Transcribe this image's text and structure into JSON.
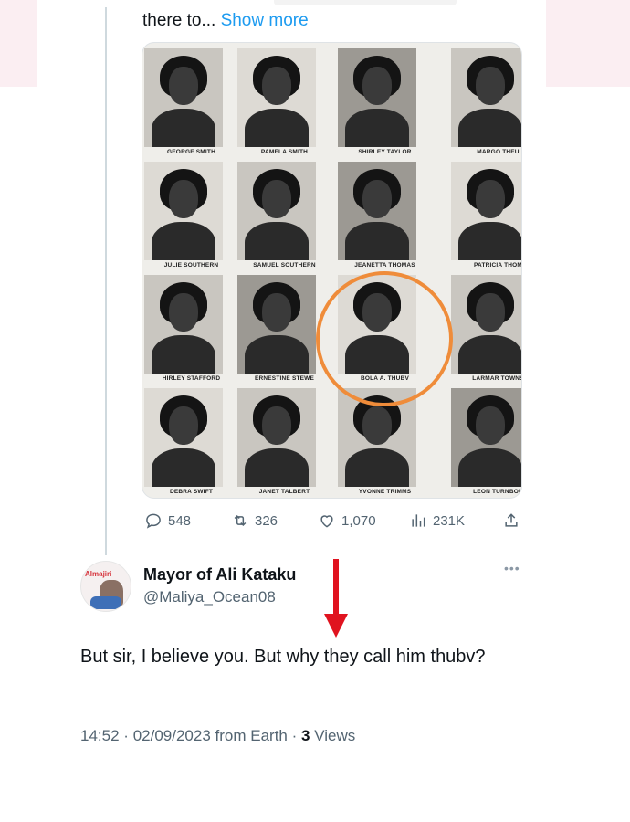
{
  "original_tweet": {
    "truncated_text": "there to...",
    "show_more_label": "Show more",
    "photo": {
      "portraits": [
        {
          "name": "GEORGE SMITH"
        },
        {
          "name": "PAMELA SMITH"
        },
        {
          "name": "SHIRLEY TAYLOR"
        },
        {
          "name": "MARGO THEU"
        },
        {
          "name": "JULIE SOUTHERN"
        },
        {
          "name": "SAMUEL SOUTHERN"
        },
        {
          "name": "JEANETTA THOMAS"
        },
        {
          "name": "PATRICIA THOM"
        },
        {
          "name": "HIRLEY STAFFORD"
        },
        {
          "name": "ERNESTINE STEWE"
        },
        {
          "name": "BOLA A. THUBV"
        },
        {
          "name": "LARMAR TOWNS"
        },
        {
          "name": "DEBRA SWIFT"
        },
        {
          "name": "JANET TALBERT"
        },
        {
          "name": "YVONNE TRIMMS"
        },
        {
          "name": "LEON TURNBOU"
        }
      ],
      "highlight_color": "#ef8c3a"
    },
    "actions": {
      "replies": "548",
      "reposts": "326",
      "likes": "1,070",
      "views": "231K"
    }
  },
  "reply": {
    "avatar_brand": "Almajiri",
    "display_name": "Mayor of Ali Kataku",
    "handle": "@Maliya_Ocean08",
    "more_label": "•••",
    "text": "But sir, I believe you. But why they call him thubv?",
    "time": "14:52",
    "date": "02/09/2023",
    "source": "from Earth",
    "views_count": "3",
    "views_label": "Views",
    "separator": "·"
  },
  "colors": {
    "link": "#1d9bf0",
    "secondary_text": "#536471",
    "arrow": "#e0131f"
  }
}
